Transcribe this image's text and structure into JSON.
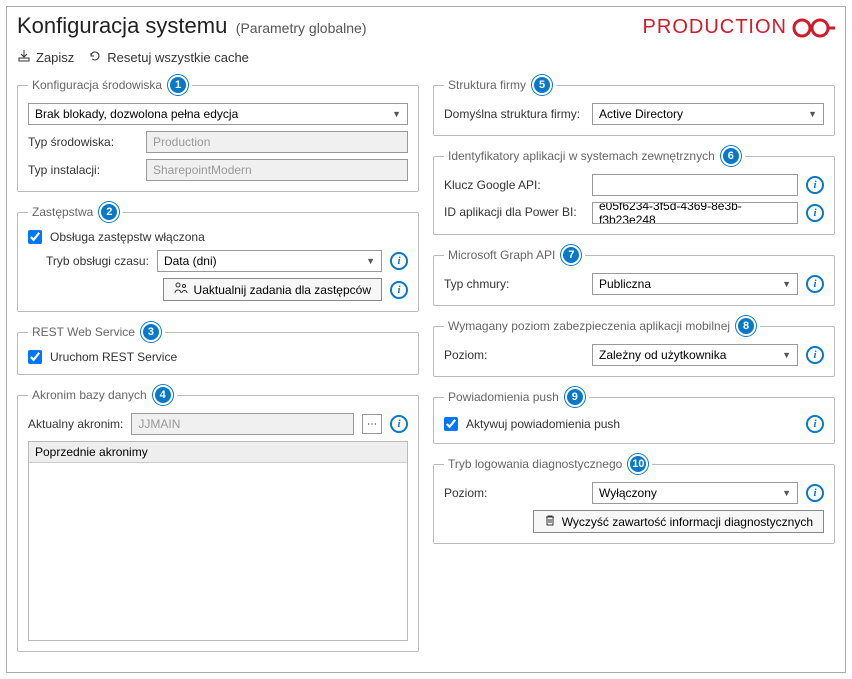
{
  "header": {
    "title": "Konfiguracja systemu",
    "subtitle": "(Parametry globalne)",
    "brand": "PRODUCTION"
  },
  "toolbar": {
    "save": "Zapisz",
    "reset": "Resetuj wszystkie cache"
  },
  "left": {
    "env": {
      "legend": "Konfiguracja środowiska",
      "lock_value": "Brak blokady, dozwolona pełna edycja",
      "type_label": "Typ środowiska:",
      "type_value": "Production",
      "install_label": "Typ instalacji:",
      "install_value": "SharepointModern"
    },
    "sub": {
      "legend": "Zastępstwa",
      "chk_label": "Obsługa zastępstw włączona",
      "chk": true,
      "mode_label": "Tryb obsługi czasu:",
      "mode_value": "Data (dni)",
      "btn": "Uaktualnij zadania dla zastępców"
    },
    "rest": {
      "legend": "REST Web Service",
      "chk_label": "Uruchom REST Service",
      "chk": true
    },
    "db": {
      "legend": "Akronim bazy danych",
      "curr_label": "Aktualny akronim:",
      "curr_value": "JJMAIN",
      "prev_header": "Poprzednie akronimy"
    }
  },
  "right": {
    "org": {
      "legend": "Struktura firmy",
      "label": "Domyślna struktura firmy:",
      "value": "Active Directory"
    },
    "ext": {
      "legend": "Identyfikatory aplikacji w systemach zewnętrznych",
      "google_label": "Klucz Google API:",
      "google_value": "",
      "bi_label": "ID aplikacji dla Power BI:",
      "bi_value": "e05f6234-3f5d-4369-8e3b-f3b23e248"
    },
    "graph": {
      "legend": "Microsoft Graph API",
      "label": "Typ chmury:",
      "value": "Publiczna"
    },
    "sec": {
      "legend": "Wymagany poziom zabezpieczenia aplikacji mobilnej",
      "label": "Poziom:",
      "value": "Zależny od użytkownika"
    },
    "push": {
      "legend": "Powiadomienia push",
      "chk_label": "Aktywuj powiadomienia push",
      "chk": true
    },
    "diag": {
      "legend": "Tryb logowania diagnostycznego",
      "label": "Poziom:",
      "value": "Wyłączony",
      "btn": "Wyczyść zawartość informacji diagnostycznych"
    }
  },
  "badges": [
    "1",
    "2",
    "3",
    "4",
    "5",
    "6",
    "7",
    "8",
    "9",
    "10"
  ]
}
